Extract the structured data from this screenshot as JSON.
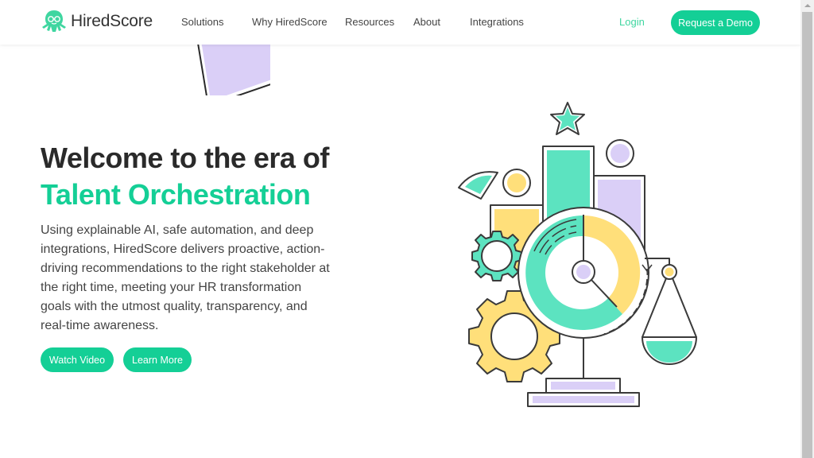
{
  "brand": {
    "name": "HiredScore",
    "accent_color": "#14cf96",
    "logo_icon": "octopus-icon"
  },
  "nav": {
    "items": [
      {
        "label": "Solutions"
      },
      {
        "label": "Why HiredScore"
      },
      {
        "label": "Resources"
      },
      {
        "label": "About"
      },
      {
        "label": "Integrations"
      }
    ],
    "login_label": "Login",
    "demo_label": "Request a Demo"
  },
  "hero": {
    "title_line1": "Welcome to the era of",
    "title_line2": "Talent Orchestration",
    "body": "Using explainable AI, safe automation, and deep integrations, HiredScore delivers proactive, action-driving recommendations to the right stakeholder at the right time, meeting your HR transformation goals with the utmost quality, transparency, and real-time awareness.",
    "buttons": [
      {
        "label": "Watch Video"
      },
      {
        "label": "Learn More"
      }
    ]
  },
  "illustration": {
    "description": "Orchestration illustration with bar chart, star, gears, donut clock and balance scale",
    "colors": {
      "green": "#5ce3c0",
      "yellow": "#ffdf7a",
      "purple": "#dacff7",
      "stroke": "#3a3a3a"
    }
  }
}
